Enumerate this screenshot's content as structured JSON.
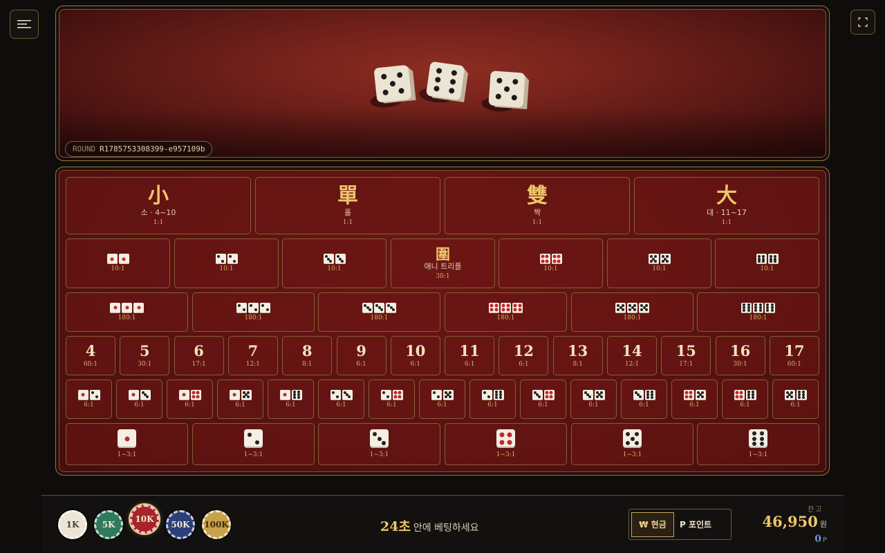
{
  "round": {
    "label": "ROUND",
    "id": "R1785753308399-e957109b"
  },
  "dice_result": [
    5,
    6,
    5
  ],
  "big_small": [
    {
      "char": "小",
      "sub": "소 · 4~10",
      "odds": "1:1"
    },
    {
      "char": "單",
      "sub": "홀",
      "odds": "1:1"
    },
    {
      "char": "雙",
      "sub": "짝",
      "odds": "1:1"
    },
    {
      "char": "大",
      "sub": "대 · 11~17",
      "odds": "1:1"
    }
  ],
  "doubles": [
    {
      "face": 1,
      "odds": "10:1"
    },
    {
      "face": 2,
      "odds": "10:1"
    },
    {
      "face": 3,
      "odds": "10:1"
    },
    {
      "any_triple": true,
      "char": "圍",
      "sub": "애니 트리플",
      "odds": "30:1"
    },
    {
      "face": 4,
      "odds": "10:1"
    },
    {
      "face": 5,
      "odds": "10:1"
    },
    {
      "face": 6,
      "odds": "10:1"
    }
  ],
  "triples": [
    {
      "face": 1,
      "odds": "180:1"
    },
    {
      "face": 2,
      "odds": "180:1"
    },
    {
      "face": 3,
      "odds": "180:1"
    },
    {
      "face": 4,
      "odds": "180:1"
    },
    {
      "face": 5,
      "odds": "180:1"
    },
    {
      "face": 6,
      "odds": "180:1"
    }
  ],
  "totals": [
    {
      "num": "4",
      "odds": "60:1"
    },
    {
      "num": "5",
      "odds": "30:1"
    },
    {
      "num": "6",
      "odds": "17:1"
    },
    {
      "num": "7",
      "odds": "12:1"
    },
    {
      "num": "8",
      "odds": "8:1"
    },
    {
      "num": "9",
      "odds": "6:1"
    },
    {
      "num": "10",
      "odds": "6:1"
    },
    {
      "num": "11",
      "odds": "6:1"
    },
    {
      "num": "12",
      "odds": "6:1"
    },
    {
      "num": "13",
      "odds": "8:1"
    },
    {
      "num": "14",
      "odds": "12:1"
    },
    {
      "num": "15",
      "odds": "17:1"
    },
    {
      "num": "16",
      "odds": "30:1"
    },
    {
      "num": "17",
      "odds": "60:1"
    }
  ],
  "combos": [
    {
      "a": 1,
      "b": 2,
      "odds": "6:1"
    },
    {
      "a": 1,
      "b": 3,
      "odds": "6:1"
    },
    {
      "a": 1,
      "b": 4,
      "odds": "6:1"
    },
    {
      "a": 1,
      "b": 5,
      "odds": "6:1"
    },
    {
      "a": 1,
      "b": 6,
      "odds": "6:1"
    },
    {
      "a": 2,
      "b": 3,
      "odds": "6:1"
    },
    {
      "a": 2,
      "b": 4,
      "odds": "6:1"
    },
    {
      "a": 2,
      "b": 5,
      "odds": "6:1"
    },
    {
      "a": 2,
      "b": 6,
      "odds": "6:1"
    },
    {
      "a": 3,
      "b": 4,
      "odds": "6:1"
    },
    {
      "a": 3,
      "b": 5,
      "odds": "6:1"
    },
    {
      "a": 3,
      "b": 6,
      "odds": "6:1"
    },
    {
      "a": 4,
      "b": 5,
      "odds": "6:1"
    },
    {
      "a": 4,
      "b": 6,
      "odds": "6:1"
    },
    {
      "a": 5,
      "b": 6,
      "odds": "6:1"
    }
  ],
  "singles": [
    {
      "face": 1,
      "odds": "1~3:1"
    },
    {
      "face": 2,
      "odds": "1~3:1"
    },
    {
      "face": 3,
      "odds": "1~3:1"
    },
    {
      "face": 4,
      "odds": "1~3:1"
    },
    {
      "face": 5,
      "odds": "1~3:1"
    },
    {
      "face": 6,
      "odds": "1~3:1"
    }
  ],
  "chips": [
    {
      "label": "1K",
      "color": "#ece5d6",
      "text_color": "#444444"
    },
    {
      "label": "5K",
      "color": "#2f7a5c",
      "text_color": "#f3ead2"
    },
    {
      "label": "10K",
      "color": "#a8242a",
      "text_color": "#f3ead2",
      "selected": true
    },
    {
      "label": "50K",
      "color": "#2c3f7a",
      "text_color": "#f3ead2"
    },
    {
      "label": "100K",
      "color": "#c9a14a",
      "text_color": "#3a2a10"
    }
  ],
  "timer": {
    "seconds": "24초",
    "message": "안에 베팅하세요"
  },
  "mode": {
    "cash": "₩ 현금",
    "points": "P 포인트"
  },
  "balance": {
    "label": "잔고",
    "amount": "46,950",
    "unit": "원",
    "points": "0",
    "points_unit": "P"
  },
  "icons": {
    "menu": "menu-icon",
    "fullscreen": "fullscreen-icon"
  }
}
